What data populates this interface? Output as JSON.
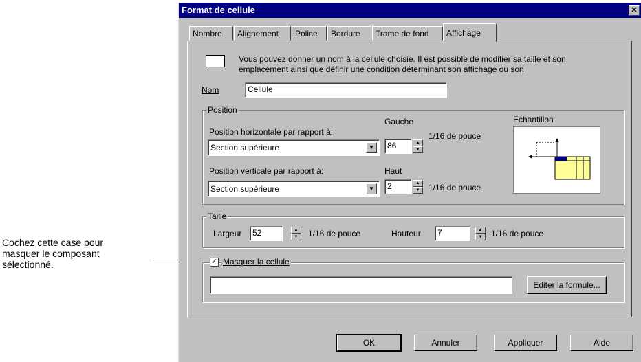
{
  "callout": {
    "line1": "Cochez cette case pour",
    "line2": "masquer le composant",
    "line3": "sélectionné."
  },
  "dialog": {
    "title": "Format de cellule",
    "close_glyph": "✕",
    "tabs": [
      {
        "label": "Nombre",
        "active": false
      },
      {
        "label": "Alignement",
        "active": false
      },
      {
        "label": "Police",
        "active": false
      },
      {
        "label": "Bordure",
        "active": false
      },
      {
        "label": "Trame de fond",
        "active": false
      },
      {
        "label": "Affichage",
        "active": true
      }
    ],
    "description": "Vous pouvez donner un nom à la cellule choisie. Il est possible de modifier sa taille et son emplacement ainsi que définir une condition déterminant son affichage ou son",
    "name": {
      "label": "Nom",
      "value": "Cellule"
    },
    "position": {
      "title": "Position",
      "horizontal_label": "Position horizontale par rapport à:",
      "horizontal_value": "Section supérieure",
      "left_label": "Gauche",
      "left_value": "86",
      "left_unit": "1/16 de pouce",
      "vertical_label": "Position verticale par rapport à:",
      "vertical_value": "Section supérieure",
      "top_label": "Haut",
      "top_value": "2",
      "top_unit": "1/16 de pouce",
      "sample_title": "Echantillon"
    },
    "size": {
      "title": "Taille",
      "width_label": "Largeur",
      "width_value": "52",
      "width_unit": "1/16 de pouce",
      "height_label": "Hauteur",
      "height_value": "7",
      "height_unit": "1/16 de pouce"
    },
    "hide": {
      "label": "Masquer la cellule",
      "checked": true,
      "check_glyph": "✓",
      "formula_value": "",
      "edit_formula_label": "Editer la formule..."
    },
    "buttons": {
      "ok": "OK",
      "cancel": "Annuler",
      "apply": "Appliquer",
      "help": "Aide"
    },
    "colors": {
      "titlebar": "#000080",
      "face": "#c0c0c0",
      "sample_fill": "#ffff99"
    }
  }
}
